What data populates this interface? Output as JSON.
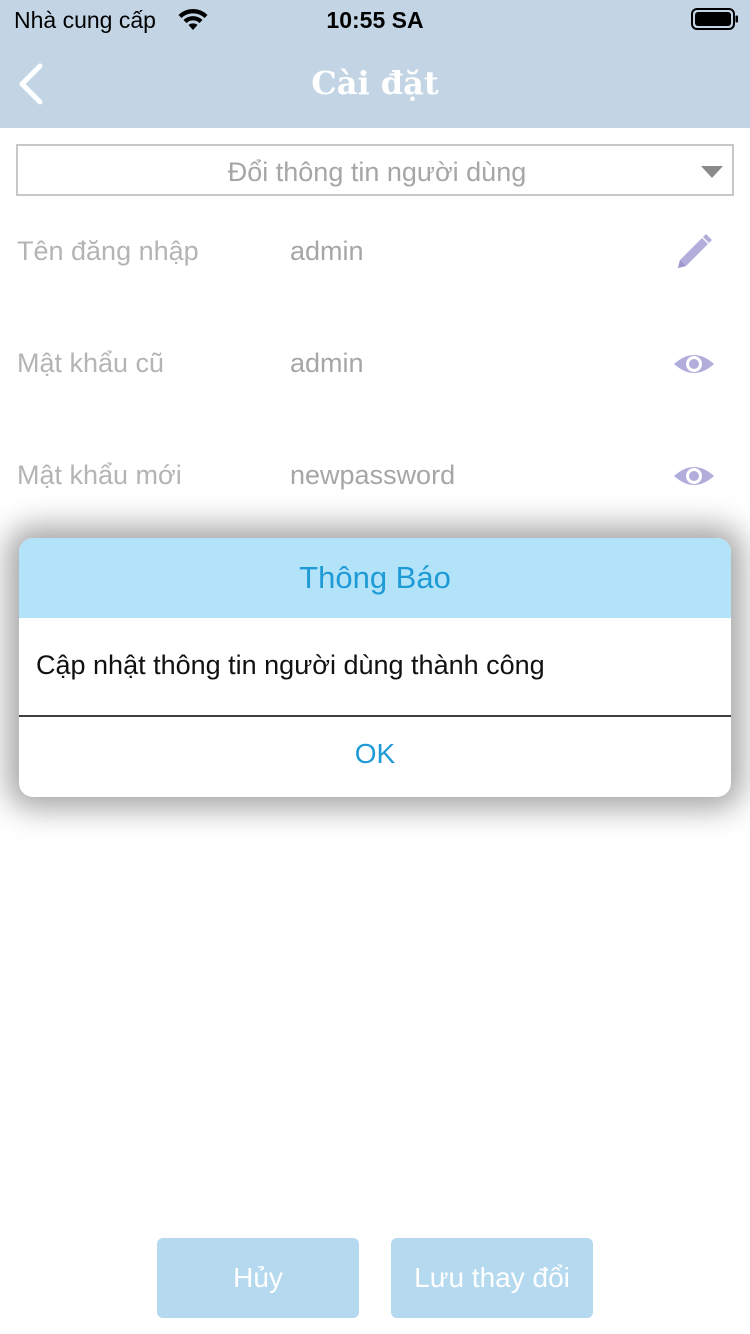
{
  "status_bar": {
    "carrier": "Nhà cung cấp",
    "time": "10:55 SA",
    "wifi_icon": "wifi-icon",
    "battery_icon": "battery-icon"
  },
  "nav": {
    "title": "Cài đặt",
    "back_icon": "chevron-left-icon",
    "background": "#c3d5e4"
  },
  "form": {
    "mode_select": {
      "value": "Đổi thông tin người dùng",
      "icon": "caret-down-icon"
    },
    "rows": [
      {
        "label": "Tên đăng nhập",
        "value": "admin",
        "icon": "pencil-icon"
      },
      {
        "label": "Mật khẩu cũ",
        "value": "admin",
        "icon": "eye-icon"
      },
      {
        "label": "Mật khẩu mới",
        "value": "newpassword",
        "icon": "eye-icon"
      }
    ]
  },
  "dialog": {
    "title": "Thông Báo",
    "message": "Cập nhật thông tin người dùng thành công",
    "ok_label": "OK",
    "accent": "#1e9ad6",
    "header_bg": "#b3e3f9"
  },
  "actions": {
    "cancel_label": "Hủy",
    "save_label": "Lưu thay đổi",
    "button_bg": "#b5d9ef"
  }
}
